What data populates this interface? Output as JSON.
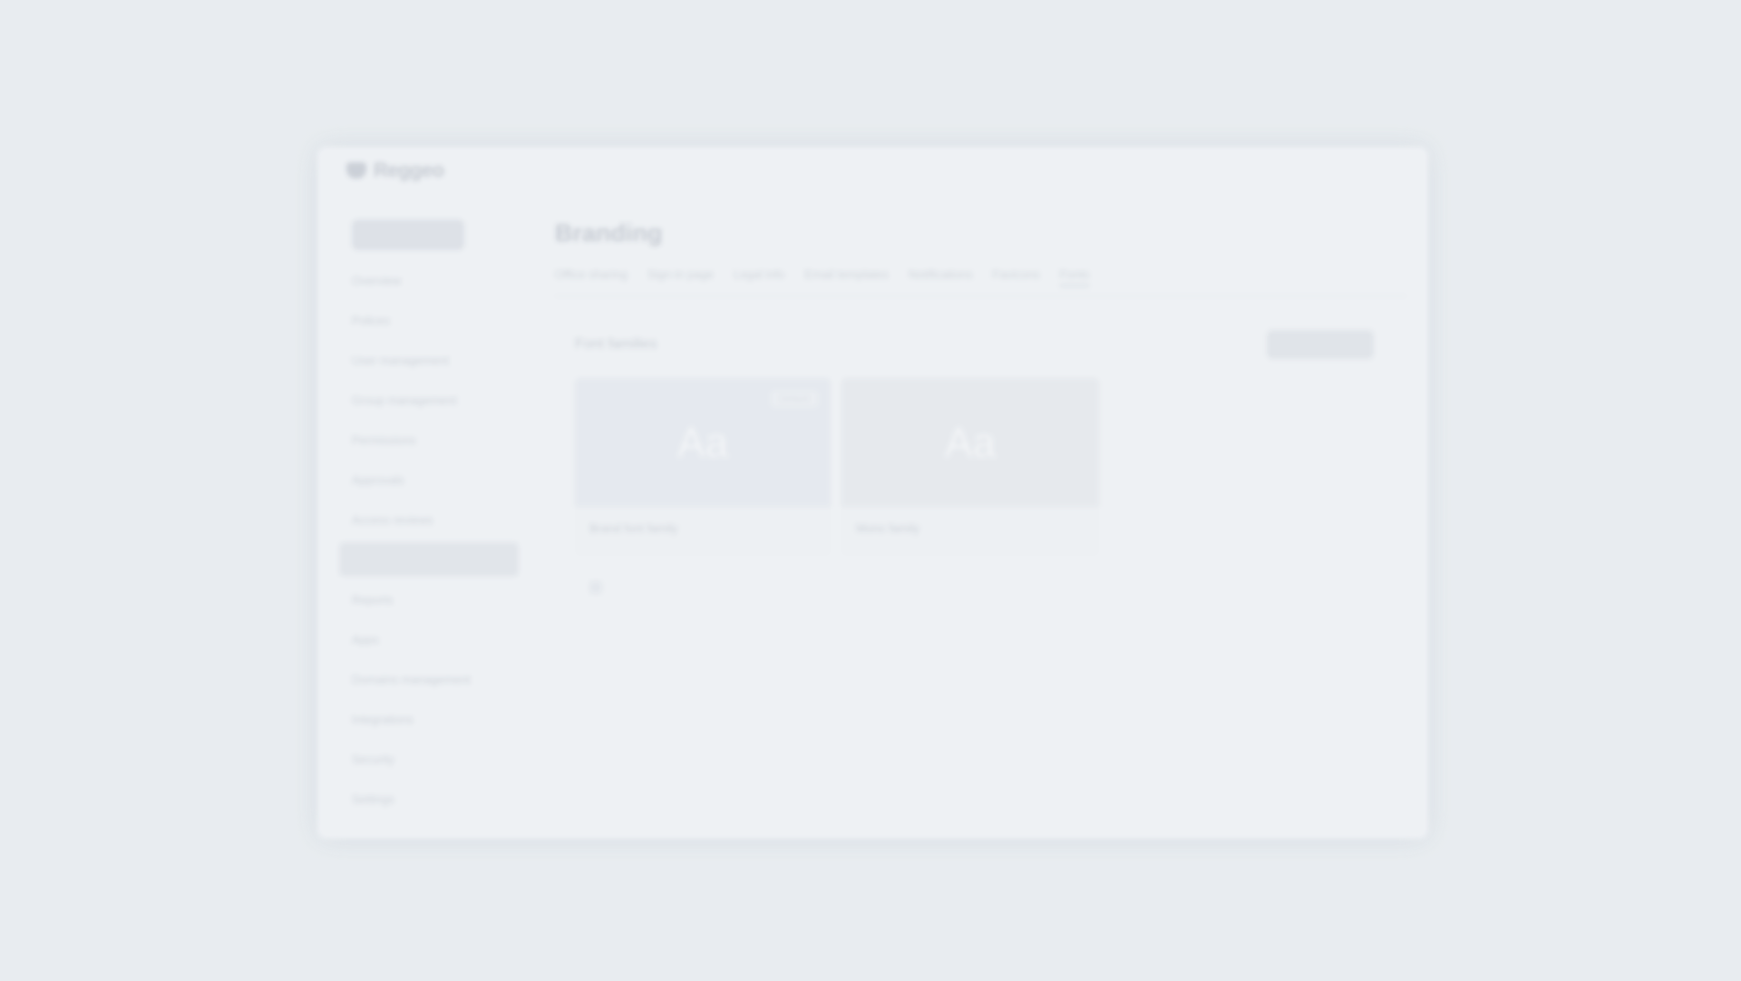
{
  "app": {
    "logo_text": "Reggeo",
    "logo_icon": "shield-logo-icon"
  },
  "sidebar": {
    "new_button_label": "",
    "items": [
      {
        "label": "Overview",
        "active": false
      },
      {
        "label": "Polices",
        "active": false
      },
      {
        "label": "User management",
        "active": false
      },
      {
        "label": "Group management",
        "active": false
      },
      {
        "label": "Permissions",
        "active": false
      },
      {
        "label": "Approvals",
        "active": false
      },
      {
        "label": "Access reviews",
        "active": false
      },
      {
        "label": "",
        "active": true
      },
      {
        "label": "Reports",
        "active": false
      },
      {
        "label": "Apps",
        "active": false
      },
      {
        "label": "Domains management",
        "active": false
      },
      {
        "label": "Integrations",
        "active": false
      },
      {
        "label": "Security",
        "active": false
      },
      {
        "label": "Settings",
        "active": false
      }
    ]
  },
  "main": {
    "page_title": "Branding",
    "tabs": [
      {
        "label": "Office sharing",
        "active": false
      },
      {
        "label": "Sign-in page",
        "active": false
      },
      {
        "label": "Legal info",
        "active": false
      },
      {
        "label": "Email templates",
        "active": false
      },
      {
        "label": "Notifications",
        "active": false
      },
      {
        "label": "Favicons",
        "active": false
      },
      {
        "label": "Fonts",
        "active": true
      }
    ],
    "section_label": "Font families",
    "add_button_label": "",
    "cards": [
      {
        "preview": "Aa",
        "badge": "Default",
        "name": "Brand font family"
      },
      {
        "preview": "Aa",
        "badge": "",
        "name": "Mono family"
      }
    ]
  },
  "colors": {
    "background": "#e8ecf0",
    "window": "#eff2f5",
    "active_nav": "#e1e5ea"
  }
}
